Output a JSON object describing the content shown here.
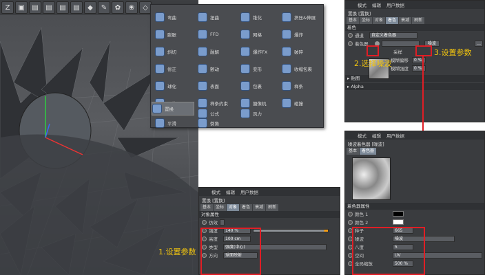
{
  "toolbar": {
    "left_icons": [
      "logo-icon",
      "cube-icon",
      "film-icon",
      "film-icon",
      "film-icon",
      "film-icon",
      "cube-icon",
      "pen-icon",
      "gear-icon",
      "flower-icon",
      "deform-icon"
    ]
  },
  "deform_menu": {
    "items": [
      {
        "label": "弯曲"
      },
      {
        "label": "膨胀"
      },
      {
        "label": "斜切"
      },
      {
        "label": "锥化"
      },
      {
        "label": "扭曲"
      },
      {
        "label": "FFD"
      },
      {
        "label": "网格"
      },
      {
        "label": "挤压&伸展"
      },
      {
        "label": "融解"
      },
      {
        "label": "爆炸"
      },
      {
        "label": "爆炸FX"
      },
      {
        "label": "破碎"
      },
      {
        "label": "修正"
      },
      {
        "label": "颤动"
      },
      {
        "label": "变形"
      },
      {
        "label": "收缩包裹"
      },
      {
        "label": "球化"
      },
      {
        "label": "表面"
      },
      {
        "label": "包裹"
      },
      {
        "label": "样条"
      },
      {
        "label": "导轨"
      },
      {
        "label": "样条约束"
      },
      {
        "label": "摄像机"
      },
      {
        "label": "碰撞"
      },
      {
        "label": "置换"
      },
      {
        "label": "公式"
      },
      {
        "label": "风力"
      },
      {
        "label": "平滑"
      },
      {
        "label": "倒角"
      }
    ]
  },
  "attr_panel_top": {
    "menu": [
      "模式",
      "编辑",
      "用户数据"
    ],
    "title": "置换 [置换]",
    "tabs": [
      "基本",
      "坐标",
      "对象",
      "着色",
      "衰减",
      "刷新"
    ],
    "section": "着色",
    "row_channel": {
      "label": "通道",
      "value": "自定义着色器"
    },
    "row_shader": {
      "label": "着色器",
      "btn": "噪波"
    },
    "rows": [
      {
        "label": "采样"
      },
      {
        "label": "模糊偏移",
        "value": "0 %"
      },
      {
        "label": "模糊强度",
        "value": "0 %"
      }
    ],
    "collapsed": [
      "贴图",
      "Alpha"
    ]
  },
  "attr_panel_mid": {
    "menu": [
      "模式",
      "编辑",
      "用户数据"
    ],
    "title": "置换 [置换]",
    "tabs": [
      "基本",
      "坐标",
      "对象",
      "着色",
      "衰减",
      "刷新"
    ],
    "section": "对象属性",
    "rows": [
      {
        "label": "仿效",
        "value": ""
      },
      {
        "label": "强度",
        "value": "140 %"
      },
      {
        "label": "高度",
        "value": "100 cm"
      },
      {
        "label": "类型",
        "value": "强度(中心)"
      },
      {
        "label": "方向",
        "value": "球面映射"
      }
    ]
  },
  "attr_panel_bottom": {
    "menu": [
      "模式",
      "编辑",
      "用户数据"
    ],
    "title": "噪波着色器 [噪波]",
    "tabs": [
      "基本",
      "着色器"
    ],
    "section": "着色器属性",
    "rows": [
      {
        "label": "颜色 1",
        "value": ""
      },
      {
        "label": "颜色 2",
        "value": ""
      },
      {
        "label": "种子",
        "value": "665"
      },
      {
        "label": "噪波",
        "value": "噪波"
      },
      {
        "label": "八度",
        "value": "5"
      },
      {
        "label": "空间",
        "value": "UV"
      },
      {
        "label": "全局缩放",
        "value": "500 %"
      }
    ]
  },
  "annotations": {
    "step1": "1.设置参数",
    "step2": "2.选择噪波",
    "step3": "3.设置参数"
  }
}
